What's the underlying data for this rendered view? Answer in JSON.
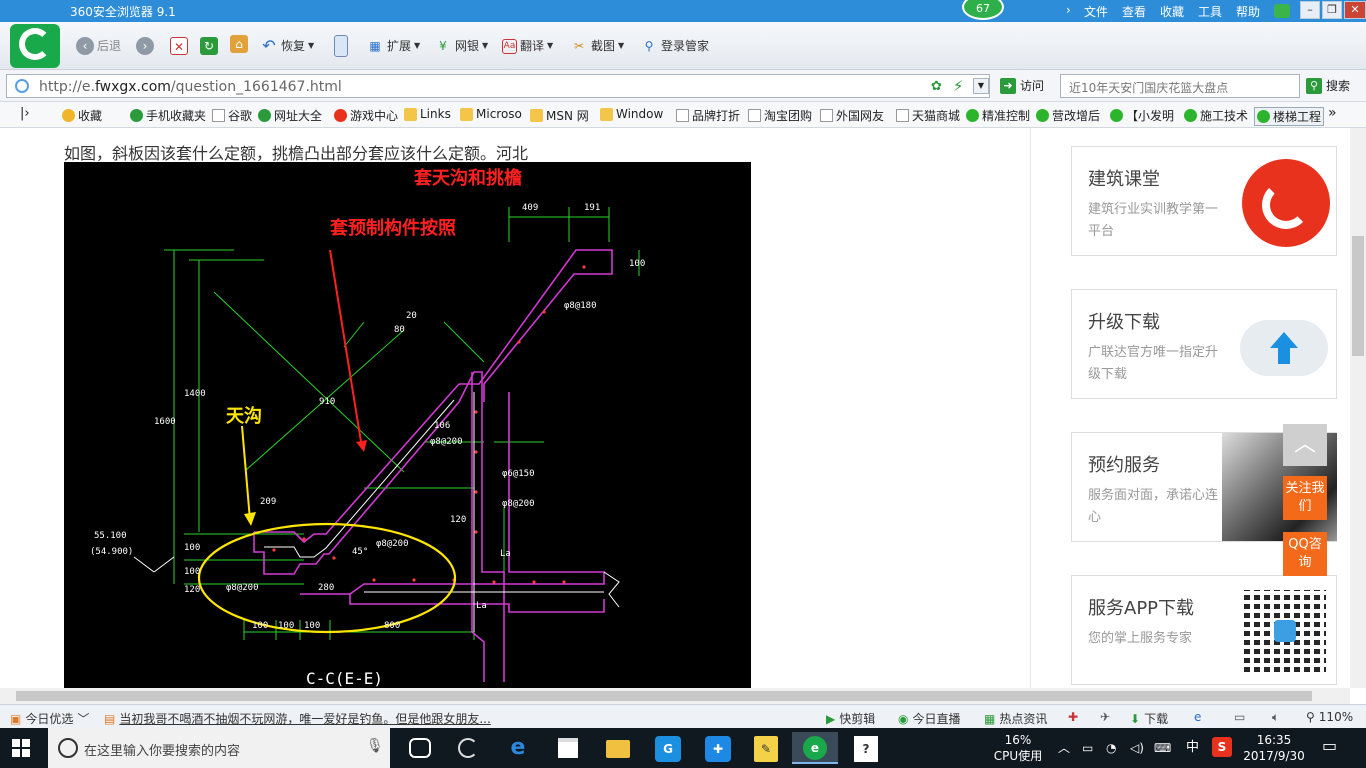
{
  "window": {
    "title": "360安全浏览器 9.1",
    "badge": "67",
    "menu": [
      "文件",
      "查看",
      "收藏",
      "工具",
      "帮助"
    ]
  },
  "toolbar": {
    "back": "后退",
    "restore": "恢复",
    "extend": "扩展",
    "bank": "网银",
    "translate": "翻译",
    "screenshot": "截图",
    "login": "登录管家"
  },
  "address": {
    "url_prefix": "http://e.",
    "url_domain": "fwxgx.com",
    "url_path": "/question_1661467.html",
    "visit": "访问",
    "search_placeholder": "近10年天安门国庆花篮大盘点",
    "search_button": "搜索"
  },
  "bookmarks": [
    {
      "label": "收藏",
      "icon": "star-icon"
    },
    {
      "label": "手机收藏夹",
      "icon": "phone-icon"
    },
    {
      "label": "谷歌",
      "icon": "page-icon"
    },
    {
      "label": "网址大全",
      "icon": "globe-icon"
    },
    {
      "label": "游戏中心",
      "icon": "game-icon"
    },
    {
      "label": "Links",
      "icon": "folder-icon"
    },
    {
      "label": "Microso",
      "icon": "folder-icon"
    },
    {
      "label": "MSN 网",
      "icon": "folder-icon"
    },
    {
      "label": "Window",
      "icon": "folder-icon"
    },
    {
      "label": "品牌打折",
      "icon": "page-icon"
    },
    {
      "label": "淘宝团购",
      "icon": "page-icon"
    },
    {
      "label": "外国网友",
      "icon": "page-icon"
    },
    {
      "label": "天猫商城",
      "icon": "page-icon"
    },
    {
      "label": "精准控制",
      "icon": "wechat-icon"
    },
    {
      "label": "营改增后",
      "icon": "wechat-icon"
    },
    {
      "label": "【小发明",
      "icon": "wechat-icon"
    },
    {
      "label": "施工技术",
      "icon": "wechat-icon"
    },
    {
      "label": "楼梯工程",
      "icon": "wechat-icon"
    }
  ],
  "content": {
    "question": "如图，斜板因该套什么定额，挑檐凸出部分套应该什么定额。河北",
    "cad": {
      "annot_red_1": "套天沟和挑檐",
      "annot_red_2": "套预制构件按照",
      "annot_yellow": "天沟",
      "section_label": "C-C(E-E)",
      "dims": [
        "409",
        "191",
        "100",
        "1600",
        "1400",
        "910",
        "80",
        "20",
        "106",
        "120",
        "55.100",
        "(54.900)",
        "100",
        "100",
        "120",
        "100",
        "100",
        "100",
        "280",
        "800",
        "La",
        "La",
        "45°",
        "209"
      ],
      "notes": [
        "φ8@180",
        "φ8@200",
        "φ6@150",
        "φ8@200",
        "φ8@200",
        "φ8@200"
      ]
    }
  },
  "sidebar": {
    "cards": [
      {
        "title": "建筑课堂",
        "sub": "建筑行业实训教学第一平台",
        "icon": "fire-logo-icon"
      },
      {
        "title": "升级下载",
        "sub": "广联达官方唯一指定升级下载",
        "icon": "cloud-upload-icon"
      },
      {
        "title": "预约服务",
        "sub": "服务面对面，承诺心连心",
        "icon": "handshake-photo-icon"
      },
      {
        "title": "服务APP下载",
        "sub": "您的掌上服务专家",
        "icon": "qr-code-icon"
      }
    ],
    "float_follow": "关注我们",
    "float_qq": "QQ咨询",
    "colors": {
      "orange": "#f36a1b",
      "gray_top": "#cfcfcf"
    }
  },
  "statusbar": {
    "today": "今日优选",
    "news": "当初我哥不喝酒不抽烟不玩网游，唯一爱好是钓鱼。但是他跟女朋友...",
    "clip": "快剪辑",
    "live": "今日直播",
    "hot": "热点资讯",
    "download": "下载",
    "zoom": "110%"
  },
  "taskbar": {
    "search_placeholder": "在这里输入你要搜索的内容",
    "cpu_pct": "16%",
    "cpu_label": "CPU使用",
    "ime": "中",
    "time": "16:35",
    "date": "2017/9/30"
  }
}
